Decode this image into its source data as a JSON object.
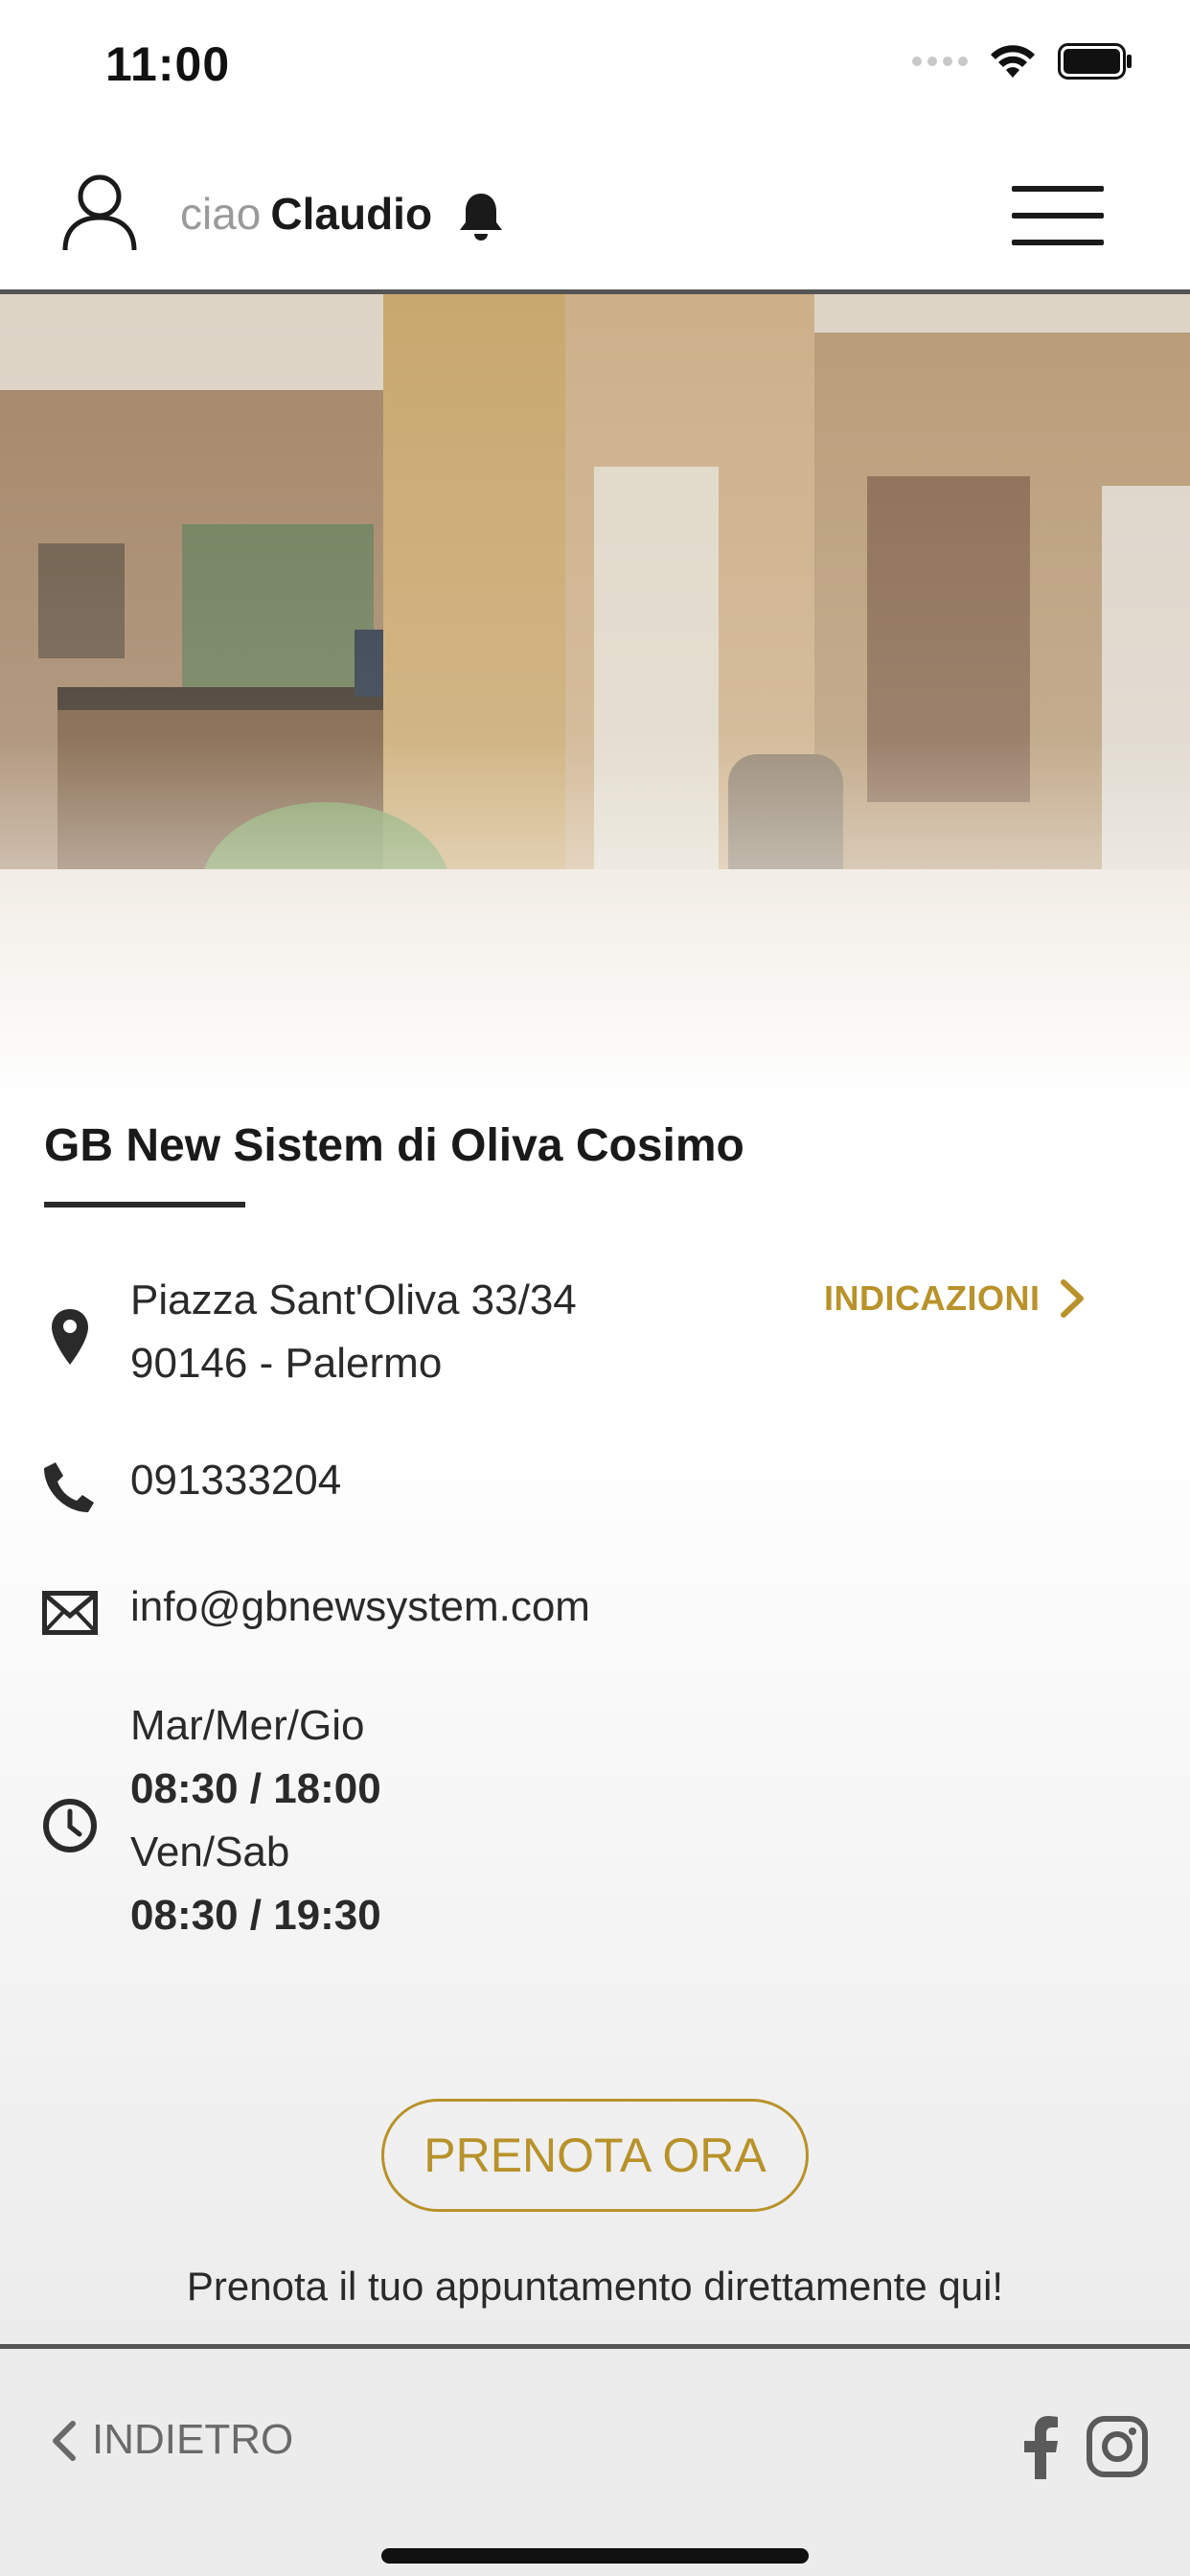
{
  "status_bar": {
    "time": "11:00"
  },
  "header": {
    "greeting_prefix": "ciao",
    "user_name": "Claudio",
    "icons": [
      "user-icon",
      "bell-icon",
      "hamburger-menu-icon"
    ]
  },
  "shop": {
    "name": "GB New Sistem di Oliva Cosimo",
    "address_line1": "Piazza Sant'Oliva 33/34",
    "address_line2": "90146 - Palermo",
    "directions_label": "INDICAZIONI",
    "phone": "091333204",
    "email": "info@gbnewsystem.com",
    "hours": [
      {
        "days": "Mar/Mer/Gio",
        "time": "08:30 / 18:00"
      },
      {
        "days": "Ven/Sab",
        "time": "08:30 / 19:30"
      }
    ]
  },
  "booking": {
    "button_label": "PRENOTA ORA",
    "caption": "Prenota il tuo appuntamento direttamente qui!"
  },
  "footer": {
    "back_label": "INDIETRO",
    "social_icons": [
      "facebook-icon",
      "instagram-icon"
    ]
  },
  "colors": {
    "accent": "#b8922a",
    "text": "#2a2a2a",
    "divider": "#555555"
  }
}
